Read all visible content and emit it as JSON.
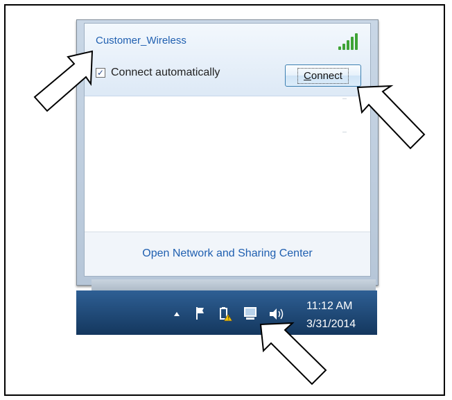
{
  "flyout": {
    "network_name": "Customer_Wireless",
    "connect_auto_label": "Connect automatically",
    "connect_auto_checked": true,
    "connect_button_label": "Connect",
    "connect_button_mnemonic": "C",
    "connect_button_rest": "onnect",
    "footer_link": "Open Network and Sharing Center",
    "signal_icon": "wifi-signal-strength-icon",
    "signal_level": 5
  },
  "taskbar": {
    "time": "11:12 AM",
    "date": "3/31/2014",
    "tray_icons": [
      "show-hidden-icons-arrow",
      "action-center-flag-icon",
      "power-warning-icon",
      "network-icon",
      "volume-icon"
    ]
  },
  "annotations": {
    "arrow_icon": "pointer-arrow-outline",
    "arrow_count": 3
  },
  "colors": {
    "link": "#1f5fb0",
    "signal": "#3ea335",
    "taskbar": "#1e4a7a"
  }
}
